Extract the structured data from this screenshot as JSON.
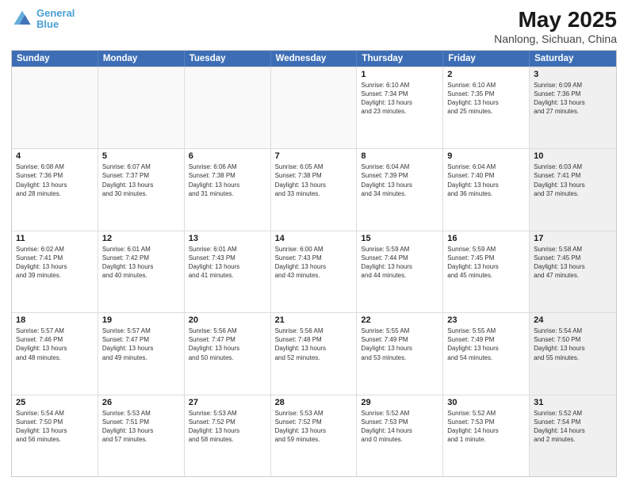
{
  "logo": {
    "line1": "General",
    "line2": "Blue"
  },
  "title": "May 2025",
  "subtitle": "Nanlong, Sichuan, China",
  "weekdays": [
    "Sunday",
    "Monday",
    "Tuesday",
    "Wednesday",
    "Thursday",
    "Friday",
    "Saturday"
  ],
  "weeks": [
    [
      {
        "day": "",
        "info": "",
        "empty": true
      },
      {
        "day": "",
        "info": "",
        "empty": true
      },
      {
        "day": "",
        "info": "",
        "empty": true
      },
      {
        "day": "",
        "info": "",
        "empty": true
      },
      {
        "day": "1",
        "info": "Sunrise: 6:10 AM\nSunset: 7:34 PM\nDaylight: 13 hours\nand 23 minutes.",
        "shaded": false
      },
      {
        "day": "2",
        "info": "Sunrise: 6:10 AM\nSunset: 7:35 PM\nDaylight: 13 hours\nand 25 minutes.",
        "shaded": false
      },
      {
        "day": "3",
        "info": "Sunrise: 6:09 AM\nSunset: 7:36 PM\nDaylight: 13 hours\nand 27 minutes.",
        "shaded": true
      }
    ],
    [
      {
        "day": "4",
        "info": "Sunrise: 6:08 AM\nSunset: 7:36 PM\nDaylight: 13 hours\nand 28 minutes.",
        "shaded": false
      },
      {
        "day": "5",
        "info": "Sunrise: 6:07 AM\nSunset: 7:37 PM\nDaylight: 13 hours\nand 30 minutes.",
        "shaded": false
      },
      {
        "day": "6",
        "info": "Sunrise: 6:06 AM\nSunset: 7:38 PM\nDaylight: 13 hours\nand 31 minutes.",
        "shaded": false
      },
      {
        "day": "7",
        "info": "Sunrise: 6:05 AM\nSunset: 7:38 PM\nDaylight: 13 hours\nand 33 minutes.",
        "shaded": false
      },
      {
        "day": "8",
        "info": "Sunrise: 6:04 AM\nSunset: 7:39 PM\nDaylight: 13 hours\nand 34 minutes.",
        "shaded": false
      },
      {
        "day": "9",
        "info": "Sunrise: 6:04 AM\nSunset: 7:40 PM\nDaylight: 13 hours\nand 36 minutes.",
        "shaded": false
      },
      {
        "day": "10",
        "info": "Sunrise: 6:03 AM\nSunset: 7:41 PM\nDaylight: 13 hours\nand 37 minutes.",
        "shaded": true
      }
    ],
    [
      {
        "day": "11",
        "info": "Sunrise: 6:02 AM\nSunset: 7:41 PM\nDaylight: 13 hours\nand 39 minutes.",
        "shaded": false
      },
      {
        "day": "12",
        "info": "Sunrise: 6:01 AM\nSunset: 7:42 PM\nDaylight: 13 hours\nand 40 minutes.",
        "shaded": false
      },
      {
        "day": "13",
        "info": "Sunrise: 6:01 AM\nSunset: 7:43 PM\nDaylight: 13 hours\nand 41 minutes.",
        "shaded": false
      },
      {
        "day": "14",
        "info": "Sunrise: 6:00 AM\nSunset: 7:43 PM\nDaylight: 13 hours\nand 43 minutes.",
        "shaded": false
      },
      {
        "day": "15",
        "info": "Sunrise: 5:59 AM\nSunset: 7:44 PM\nDaylight: 13 hours\nand 44 minutes.",
        "shaded": false
      },
      {
        "day": "16",
        "info": "Sunrise: 5:59 AM\nSunset: 7:45 PM\nDaylight: 13 hours\nand 45 minutes.",
        "shaded": false
      },
      {
        "day": "17",
        "info": "Sunrise: 5:58 AM\nSunset: 7:45 PM\nDaylight: 13 hours\nand 47 minutes.",
        "shaded": true
      }
    ],
    [
      {
        "day": "18",
        "info": "Sunrise: 5:57 AM\nSunset: 7:46 PM\nDaylight: 13 hours\nand 48 minutes.",
        "shaded": false
      },
      {
        "day": "19",
        "info": "Sunrise: 5:57 AM\nSunset: 7:47 PM\nDaylight: 13 hours\nand 49 minutes.",
        "shaded": false
      },
      {
        "day": "20",
        "info": "Sunrise: 5:56 AM\nSunset: 7:47 PM\nDaylight: 13 hours\nand 50 minutes.",
        "shaded": false
      },
      {
        "day": "21",
        "info": "Sunrise: 5:56 AM\nSunset: 7:48 PM\nDaylight: 13 hours\nand 52 minutes.",
        "shaded": false
      },
      {
        "day": "22",
        "info": "Sunrise: 5:55 AM\nSunset: 7:49 PM\nDaylight: 13 hours\nand 53 minutes.",
        "shaded": false
      },
      {
        "day": "23",
        "info": "Sunrise: 5:55 AM\nSunset: 7:49 PM\nDaylight: 13 hours\nand 54 minutes.",
        "shaded": false
      },
      {
        "day": "24",
        "info": "Sunrise: 5:54 AM\nSunset: 7:50 PM\nDaylight: 13 hours\nand 55 minutes.",
        "shaded": true
      }
    ],
    [
      {
        "day": "25",
        "info": "Sunrise: 5:54 AM\nSunset: 7:50 PM\nDaylight: 13 hours\nand 56 minutes.",
        "shaded": false
      },
      {
        "day": "26",
        "info": "Sunrise: 5:53 AM\nSunset: 7:51 PM\nDaylight: 13 hours\nand 57 minutes.",
        "shaded": false
      },
      {
        "day": "27",
        "info": "Sunrise: 5:53 AM\nSunset: 7:52 PM\nDaylight: 13 hours\nand 58 minutes.",
        "shaded": false
      },
      {
        "day": "28",
        "info": "Sunrise: 5:53 AM\nSunset: 7:52 PM\nDaylight: 13 hours\nand 59 minutes.",
        "shaded": false
      },
      {
        "day": "29",
        "info": "Sunrise: 5:52 AM\nSunset: 7:53 PM\nDaylight: 14 hours\nand 0 minutes.",
        "shaded": false
      },
      {
        "day": "30",
        "info": "Sunrise: 5:52 AM\nSunset: 7:53 PM\nDaylight: 14 hours\nand 1 minute.",
        "shaded": false
      },
      {
        "day": "31",
        "info": "Sunrise: 5:52 AM\nSunset: 7:54 PM\nDaylight: 14 hours\nand 2 minutes.",
        "shaded": true
      }
    ]
  ]
}
